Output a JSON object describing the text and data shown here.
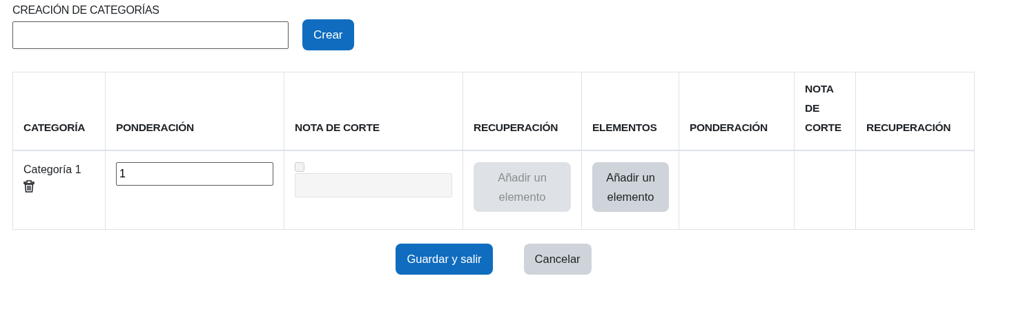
{
  "creation_form": {
    "label": "CREACIÓN DE CATEGORÍAS",
    "create_button": "Crear"
  },
  "table": {
    "columns": [
      "CATEGORÍA",
      "PONDERACIÓN",
      "NOTA DE CORTE",
      "RECUPERACIÓN",
      "ELEMENTOS",
      "PONDERACIÓN",
      "NOTA DE CORTE",
      "RECUPERACIÓN"
    ],
    "rows": [
      {
        "category": "Categoría 1",
        "weight": "1",
        "cutoff_checked": false,
        "cutoff_disabled": true,
        "recovery_button": {
          "label": "Añadir un elemento",
          "disabled": true
        },
        "elements_button": {
          "label": "Añadir un elemento",
          "disabled": false
        }
      }
    ]
  },
  "actions": [
    {
      "label": "Guardar y salir",
      "kind": "primary"
    },
    {
      "label": "Cancelar",
      "kind": "secondary"
    }
  ]
}
